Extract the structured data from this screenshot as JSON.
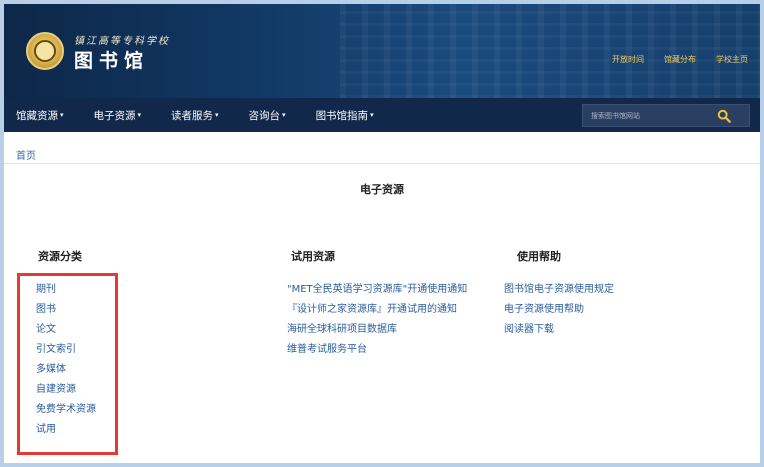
{
  "header": {
    "school_name": "镇江高等专科学校",
    "library_title": "图书馆",
    "top_links": [
      "开放时间",
      "馆藏分布",
      "学校主页"
    ]
  },
  "nav": {
    "items": [
      "馆藏资源",
      "电子资源",
      "读者服务",
      "咨询台",
      "图书馆指南"
    ],
    "search_placeholder": "搜索图书馆网站"
  },
  "breadcrumb": "首页",
  "page_title": "电子资源",
  "columns": {
    "categories": {
      "heading": "资源分类",
      "items": [
        "期刊",
        "图书",
        "论文",
        "引文索引",
        "多媒体",
        "自建资源",
        "免费学术资源",
        "试用"
      ]
    },
    "trials": {
      "heading": "试用资源",
      "items": [
        "\"MET全民英语学习资源库\"开通使用通知",
        "『设计师之家资源库』开通试用的通知",
        "海研全球科研项目数据库",
        "维普考试服务平台"
      ]
    },
    "help": {
      "heading": "使用帮助",
      "items": [
        "图书馆电子资源使用规定",
        "电子资源使用帮助",
        "阅读器下载"
      ]
    }
  },
  "colors": {
    "header_bg": "#123a66",
    "nav_bg": "#11284b",
    "accent_gold": "#f2c95b",
    "link_blue": "#2b5d9b",
    "highlight_red": "#e53935"
  }
}
